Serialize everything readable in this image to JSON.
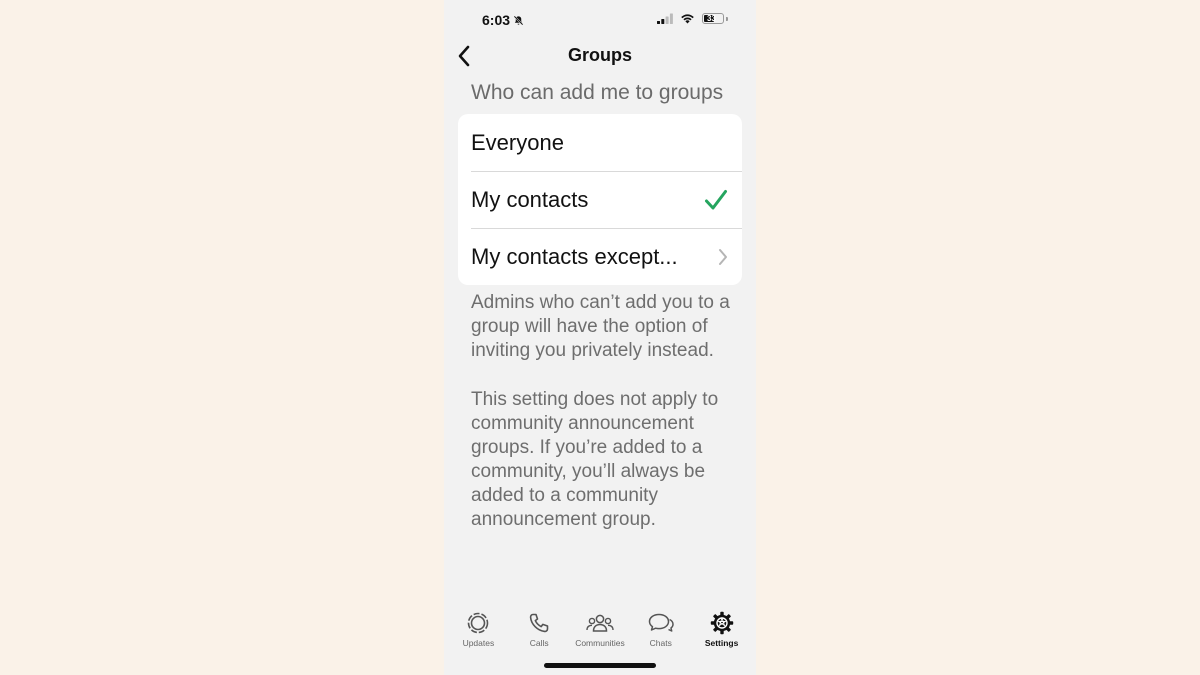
{
  "status_bar": {
    "time": "6:03",
    "battery": "33"
  },
  "nav": {
    "title": "Groups",
    "back_icon": "chevron-left-icon"
  },
  "section": {
    "header": "Who can add me to groups",
    "options": [
      {
        "label": "Everyone",
        "selected": false,
        "accessory": "none"
      },
      {
        "label": "My contacts",
        "selected": true,
        "accessory": "checkmark-icon"
      },
      {
        "label": "My contacts except...",
        "selected": false,
        "accessory": "chevron-right-icon"
      }
    ]
  },
  "footer": {
    "note1": "Admins who can’t add you to a group will have the option of inviting you privately instead.",
    "note2": "This setting does not apply to community announcement groups. If you’re added to a community, you’ll always be added to a community announcement group."
  },
  "tab_bar": {
    "tabs": [
      {
        "label": "Updates",
        "icon": "updates-icon",
        "active": false
      },
      {
        "label": "Calls",
        "icon": "phone-icon",
        "active": false
      },
      {
        "label": "Communities",
        "icon": "communities-icon",
        "active": false
      },
      {
        "label": "Chats",
        "icon": "chats-icon",
        "active": false
      },
      {
        "label": "Settings",
        "icon": "gear-icon",
        "active": true
      }
    ]
  },
  "colors": {
    "checkmark": "#25a55f",
    "background": "#faf2e8",
    "screen": "#f2f2f2"
  }
}
